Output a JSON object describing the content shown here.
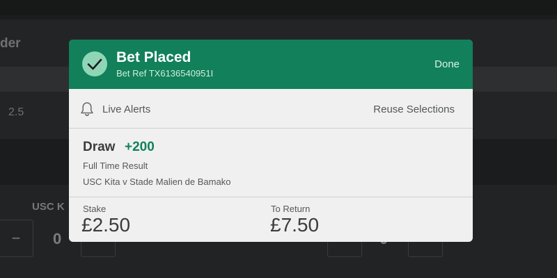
{
  "background": {
    "header_fragment": "der",
    "row_value": "2.5",
    "team_fragment": "USC K",
    "minus_label": "−",
    "plus_label": "+",
    "left_stake": "0",
    "right_stake": "0"
  },
  "confirmation": {
    "title": "Bet Placed",
    "bet_ref": "Bet Ref TX6136540951I",
    "done_label": "Done",
    "live_alerts_label": "Live Alerts",
    "reuse_label": "Reuse Selections",
    "selection": {
      "name": "Draw",
      "odds": "+200",
      "market": "Full Time Result",
      "event": "USC Kita v Stade Malien de Bamako"
    },
    "stake_label": "Stake",
    "stake_value": "£2.50",
    "return_label": "To Return",
    "return_value": "£7.50"
  },
  "colors": {
    "header_green": "#12805a",
    "check_circle": "#8fd6b7",
    "odds_green": "#12805a",
    "modal_bg": "#f0f0f0",
    "page_bg": "#1b1c1d"
  },
  "icons": {
    "check": "check-icon",
    "bell": "bell-icon"
  }
}
